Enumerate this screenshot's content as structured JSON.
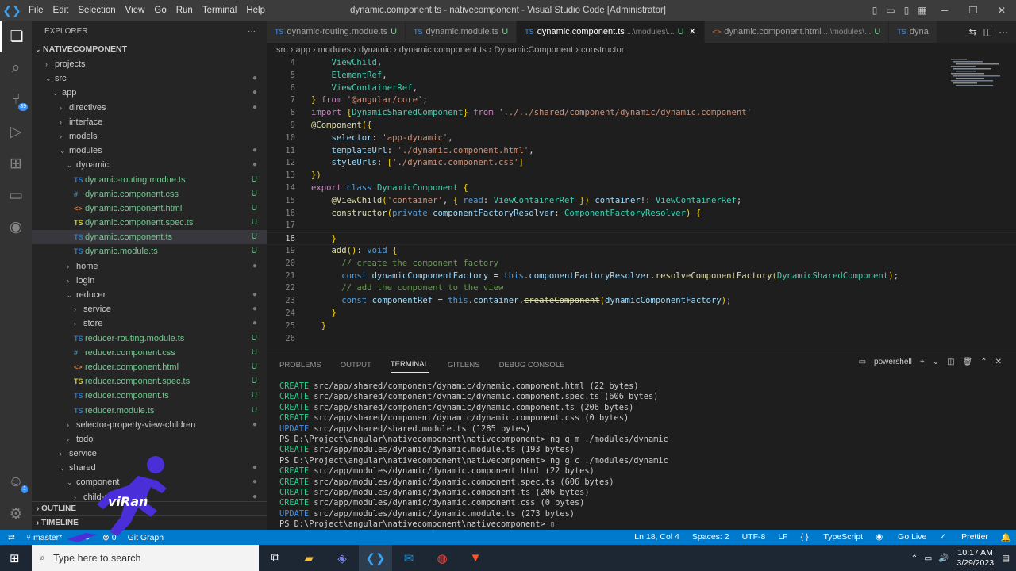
{
  "titlebar": {
    "menus": [
      "File",
      "Edit",
      "Selection",
      "View",
      "Go",
      "Run",
      "Terminal",
      "Help"
    ],
    "title": "dynamic.component.ts - nativecomponent - Visual Studio Code [Administrator]"
  },
  "activity": {
    "badge_scm": "39",
    "badge_account": "1"
  },
  "explorer": {
    "header": "EXPLORER",
    "root": "NATIVECOMPONENT",
    "items": [
      {
        "label": "projects",
        "indent": 1,
        "chev": "›",
        "icon": "",
        "cls": "",
        "st": "",
        "stc": ""
      },
      {
        "label": "src",
        "indent": 1,
        "chev": "⌄",
        "icon": "",
        "cls": "",
        "st": "●",
        "stc": "dot"
      },
      {
        "label": "app",
        "indent": 2,
        "chev": "⌄",
        "icon": "",
        "cls": "",
        "st": "●",
        "stc": "dot"
      },
      {
        "label": "directives",
        "indent": 3,
        "chev": "›",
        "icon": "",
        "cls": "",
        "st": "●",
        "stc": "dot"
      },
      {
        "label": "interface",
        "indent": 3,
        "chev": "›",
        "icon": "",
        "cls": "",
        "st": "",
        "stc": ""
      },
      {
        "label": "models",
        "indent": 3,
        "chev": "›",
        "icon": "",
        "cls": "",
        "st": "",
        "stc": ""
      },
      {
        "label": "modules",
        "indent": 3,
        "chev": "⌄",
        "icon": "",
        "cls": "",
        "st": "●",
        "stc": "dot"
      },
      {
        "label": "dynamic",
        "indent": 4,
        "chev": "⌄",
        "icon": "",
        "cls": "",
        "st": "●",
        "stc": "dot"
      },
      {
        "label": "dynamic-routing.modue.ts",
        "indent": 5,
        "chev": "",
        "icon": "TS",
        "cls": "ts",
        "st": "U",
        "stc": "u"
      },
      {
        "label": "dynamic.component.css",
        "indent": 5,
        "chev": "",
        "icon": "#",
        "cls": "css",
        "st": "U",
        "stc": "u"
      },
      {
        "label": "dynamic.component.html",
        "indent": 5,
        "chev": "",
        "icon": "<>",
        "cls": "html",
        "st": "U",
        "stc": "u"
      },
      {
        "label": "dynamic.component.spec.ts",
        "indent": 5,
        "chev": "",
        "icon": "TS",
        "cls": "spec",
        "st": "U",
        "stc": "u"
      },
      {
        "label": "dynamic.component.ts",
        "indent": 5,
        "chev": "",
        "icon": "TS",
        "cls": "ts",
        "st": "U",
        "stc": "u",
        "sel": true
      },
      {
        "label": "dynamic.module.ts",
        "indent": 5,
        "chev": "",
        "icon": "TS",
        "cls": "ts",
        "st": "U",
        "stc": "u"
      },
      {
        "label": "home",
        "indent": 4,
        "chev": "›",
        "icon": "",
        "cls": "",
        "st": "●",
        "stc": "dot"
      },
      {
        "label": "login",
        "indent": 4,
        "chev": "›",
        "icon": "",
        "cls": "",
        "st": "",
        "stc": ""
      },
      {
        "label": "reducer",
        "indent": 4,
        "chev": "⌄",
        "icon": "",
        "cls": "",
        "st": "●",
        "stc": "dot"
      },
      {
        "label": "service",
        "indent": 5,
        "chev": "›",
        "icon": "",
        "cls": "",
        "st": "●",
        "stc": "dot"
      },
      {
        "label": "store",
        "indent": 5,
        "chev": "›",
        "icon": "",
        "cls": "",
        "st": "●",
        "stc": "dot"
      },
      {
        "label": "reducer-routing.module.ts",
        "indent": 5,
        "chev": "",
        "icon": "TS",
        "cls": "ts",
        "st": "U",
        "stc": "u"
      },
      {
        "label": "reducer.component.css",
        "indent": 5,
        "chev": "",
        "icon": "#",
        "cls": "css",
        "st": "U",
        "stc": "u"
      },
      {
        "label": "reducer.component.html",
        "indent": 5,
        "chev": "",
        "icon": "<>",
        "cls": "html",
        "st": "U",
        "stc": "u"
      },
      {
        "label": "reducer.component.spec.ts",
        "indent": 5,
        "chev": "",
        "icon": "TS",
        "cls": "spec",
        "st": "U",
        "stc": "u"
      },
      {
        "label": "reducer.component.ts",
        "indent": 5,
        "chev": "",
        "icon": "TS",
        "cls": "ts",
        "st": "U",
        "stc": "u"
      },
      {
        "label": "reducer.module.ts",
        "indent": 5,
        "chev": "",
        "icon": "TS",
        "cls": "ts",
        "st": "U",
        "stc": "u"
      },
      {
        "label": "selector-property-view-children",
        "indent": 4,
        "chev": "›",
        "icon": "",
        "cls": "",
        "st": "●",
        "stc": "dot"
      },
      {
        "label": "todo",
        "indent": 4,
        "chev": "›",
        "icon": "",
        "cls": "",
        "st": "",
        "stc": ""
      },
      {
        "label": "service",
        "indent": 3,
        "chev": "›",
        "icon": "",
        "cls": "",
        "st": "",
        "stc": ""
      },
      {
        "label": "shared",
        "indent": 3,
        "chev": "⌄",
        "icon": "",
        "cls": "",
        "st": "●",
        "stc": "dot"
      },
      {
        "label": "component",
        "indent": 4,
        "chev": "⌄",
        "icon": "",
        "cls": "",
        "st": "●",
        "stc": "dot"
      },
      {
        "label": "child-component",
        "indent": 5,
        "chev": "›",
        "icon": "",
        "cls": "",
        "st": "●",
        "stc": "dot"
      }
    ],
    "outline": "OUTLINE",
    "timeline": "TIMELINE"
  },
  "tabs": [
    {
      "name": "dynamic-routing.modue.ts",
      "hint": "",
      "kind": "ts",
      "active": false
    },
    {
      "name": "dynamic.module.ts",
      "hint": "",
      "kind": "ts",
      "active": false
    },
    {
      "name": "dynamic.component.ts",
      "hint": " ...\\modules\\...",
      "kind": "ts",
      "active": true
    },
    {
      "name": "dynamic.component.html",
      "hint": " ...\\modules\\...",
      "kind": "html",
      "active": false
    },
    {
      "name": "dyna",
      "hint": "",
      "kind": "ts",
      "active": false
    }
  ],
  "breadcrumb": [
    "src",
    "app",
    "modules",
    "dynamic",
    "dynamic.component.ts",
    "DynamicComponent",
    "constructor"
  ],
  "code_lines": [
    {
      "n": "4",
      "t": "    ViewChild,",
      "cur": false
    },
    {
      "n": "5",
      "t": "    ElementRef,",
      "cur": false
    },
    {
      "n": "6",
      "t": "    ViewContainerRef,",
      "cur": false
    },
    {
      "n": "7",
      "t": "} from '@angular/core';",
      "cur": false
    },
    {
      "n": "8",
      "t": "import {DynamicSharedComponent} from '../../shared/component/dynamic/dynamic.component'",
      "cur": false
    },
    {
      "n": "9",
      "t": "@Component({",
      "cur": false
    },
    {
      "n": "10",
      "t": "    selector: 'app-dynamic',",
      "cur": false
    },
    {
      "n": "11",
      "t": "    templateUrl: './dynamic.component.html',",
      "cur": false
    },
    {
      "n": "12",
      "t": "    styleUrls: ['./dynamic.component.css']",
      "cur": false
    },
    {
      "n": "13",
      "t": "})",
      "cur": false
    },
    {
      "n": "14",
      "t": "export class DynamicComponent {",
      "cur": false
    },
    {
      "n": "15",
      "t": "    @ViewChild('container', { read: ViewContainerRef }) container!: ViewContainerRef;",
      "cur": false
    },
    {
      "n": "16",
      "t": "    constructor(private componentFactoryResolver: ComponentFactoryResolver) {",
      "cur": false
    },
    {
      "n": "17",
      "t": "",
      "cur": false
    },
    {
      "n": "18",
      "t": "    }",
      "cur": true
    },
    {
      "n": "19",
      "t": "    add(): void {",
      "cur": false
    },
    {
      "n": "20",
      "t": "      // create the component factory",
      "cur": false
    },
    {
      "n": "21",
      "t": "      const dynamicComponentFactory = this.componentFactoryResolver.resolveComponentFactory(DynamicSharedComponent);",
      "cur": false
    },
    {
      "n": "22",
      "t": "      // add the component to the view",
      "cur": false
    },
    {
      "n": "23",
      "t": "      const componentRef = this.container.createComponent(dynamicComponentFactory);",
      "cur": false
    },
    {
      "n": "24",
      "t": "    }",
      "cur": false
    },
    {
      "n": "25",
      "t": "  }",
      "cur": false
    },
    {
      "n": "26",
      "t": "",
      "cur": false
    }
  ],
  "panel": {
    "tabs": [
      "PROBLEMS",
      "OUTPUT",
      "TERMINAL",
      "GITLENS",
      "DEBUG CONSOLE"
    ],
    "active": "TERMINAL",
    "shell": "powershell"
  },
  "terminal": [
    {
      "tag": "CREATE",
      "rest": " src/app/shared/component/dynamic/dynamic.component.html (22 bytes)"
    },
    {
      "tag": "CREATE",
      "rest": " src/app/shared/component/dynamic/dynamic.component.spec.ts (606 bytes)"
    },
    {
      "tag": "CREATE",
      "rest": " src/app/shared/component/dynamic/dynamic.component.ts (206 bytes)"
    },
    {
      "tag": "CREATE",
      "rest": " src/app/shared/component/dynamic/dynamic.component.css (0 bytes)"
    },
    {
      "tag": "UPDATE",
      "rest": " src/app/shared/shared.module.ts (1285 bytes)"
    },
    {
      "tag": "",
      "rest": "PS D:\\Project\\angular\\nativecomponent\\nativecomponent> ng g m ./modules/dynamic"
    },
    {
      "tag": "CREATE",
      "rest": " src/app/modules/dynamic/dynamic.module.ts (193 bytes)"
    },
    {
      "tag": "",
      "rest": "PS D:\\Project\\angular\\nativecomponent\\nativecomponent> ng g c ./modules/dynamic"
    },
    {
      "tag": "CREATE",
      "rest": " src/app/modules/dynamic/dynamic.component.html (22 bytes)"
    },
    {
      "tag": "CREATE",
      "rest": " src/app/modules/dynamic/dynamic.component.spec.ts (606 bytes)"
    },
    {
      "tag": "CREATE",
      "rest": " src/app/modules/dynamic/dynamic.component.ts (206 bytes)"
    },
    {
      "tag": "CREATE",
      "rest": " src/app/modules/dynamic/dynamic.component.css (0 bytes)"
    },
    {
      "tag": "UPDATE",
      "rest": " src/app/modules/dynamic/dynamic.module.ts (273 bytes)"
    },
    {
      "tag": "",
      "rest": "PS D:\\Project\\angular\\nativecomponent\\nativecomponent> "
    }
  ],
  "status": {
    "branch": "master*",
    "errors": "⊗ 0",
    "gitgraph": "Git Graph",
    "position": "Ln 18, Col 4",
    "spaces": "Spaces: 2",
    "encoding": "UTF-8",
    "eol": "LF",
    "language": "TypeScript",
    "golive": "Go Live",
    "prettier": "Prettier"
  },
  "taskbar": {
    "search_placeholder": "Type here to search",
    "time": "10:17 AM",
    "date": "3/29/2023"
  },
  "watermark": "viRan",
  "colors": {
    "accent": "#007acc",
    "sidebar": "#252526",
    "editor": "#1e1e1e"
  }
}
